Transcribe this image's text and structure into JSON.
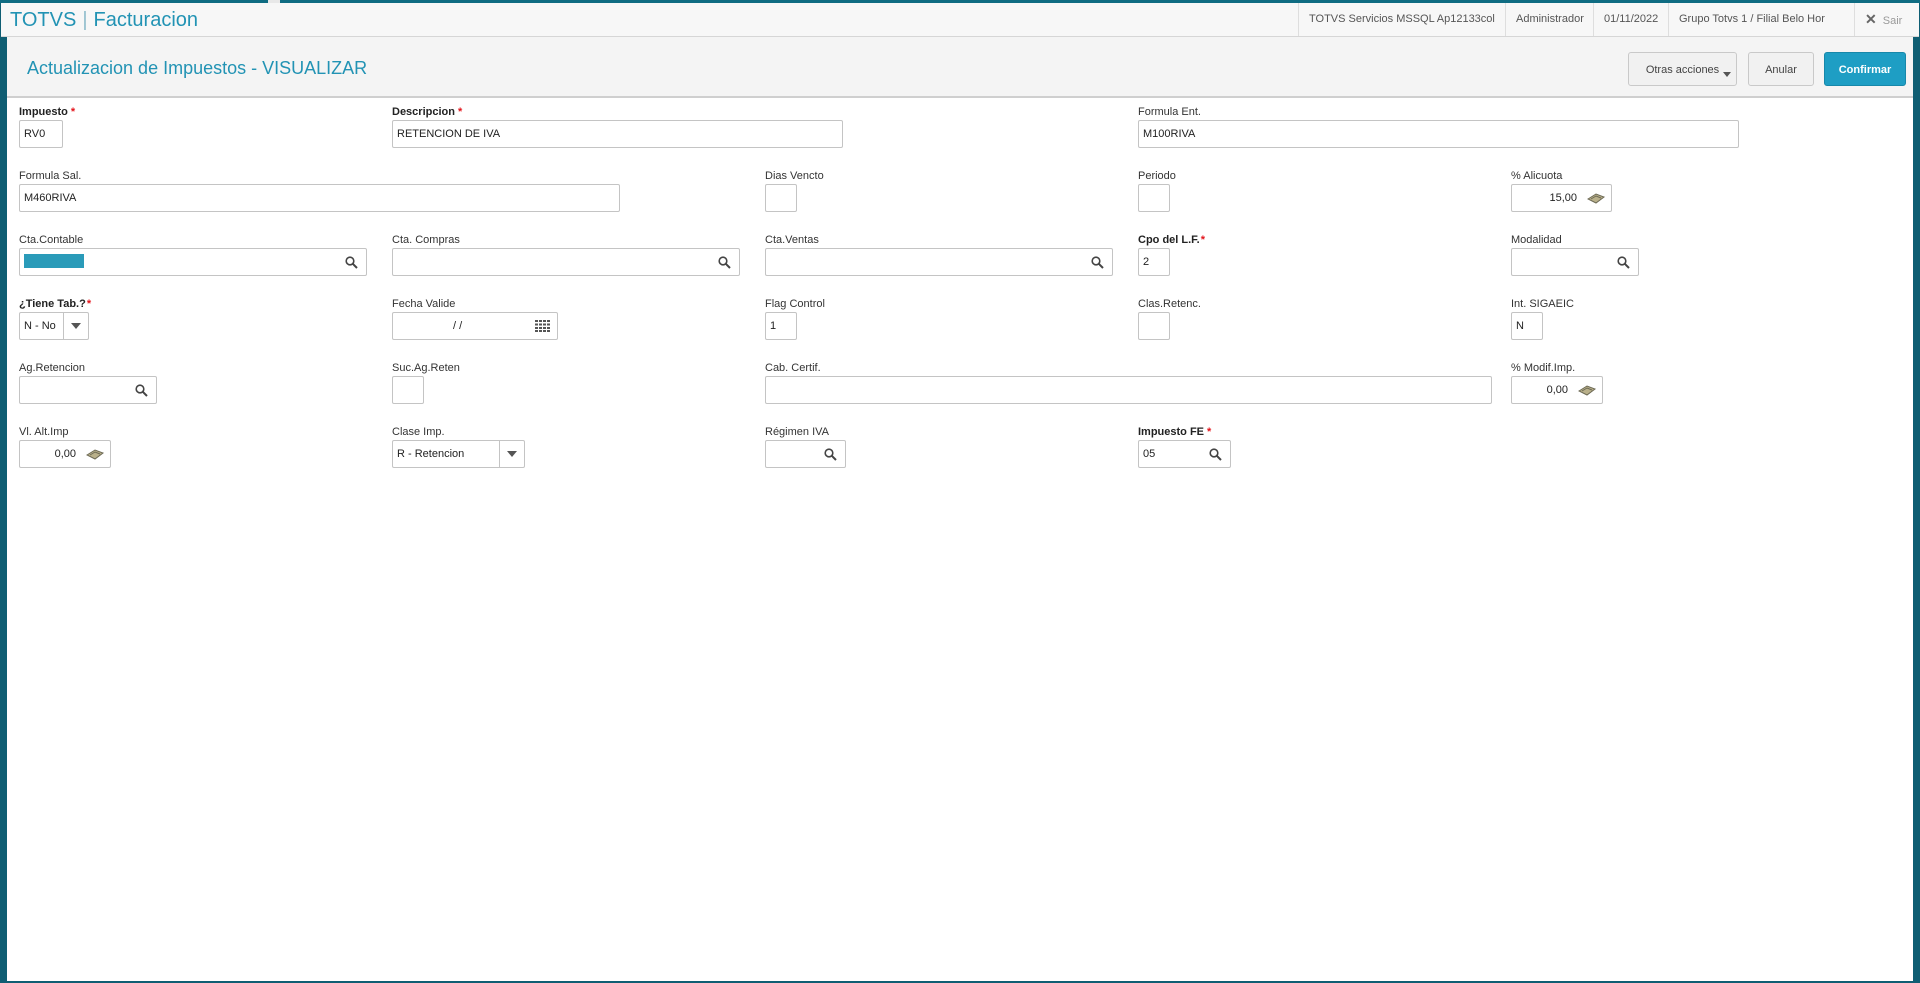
{
  "header": {
    "brand": "TOTVS",
    "module": "Facturacion",
    "server": "TOTVS Servicios MSSQL Ap12133col",
    "user": "Administrador",
    "date": "01/11/2022",
    "branch": "Grupo Totvs 1 / Filial Belo Hor",
    "exit_label": "Sair"
  },
  "page": {
    "title": "Actualizacion de Impuestos - VISUALIZAR",
    "other_actions_label": "Otras acciones",
    "cancel_label": "Anular",
    "confirm_label": "Confirmar"
  },
  "form": {
    "impuesto": {
      "label": "Impuesto",
      "value": "RV0"
    },
    "descripcion": {
      "label": "Descripcion",
      "value": "RETENCION DE IVA"
    },
    "formula_ent": {
      "label": "Formula Ent.",
      "value": "M100RIVA"
    },
    "formula_sal": {
      "label": "Formula Sal.",
      "value": "M460RIVA"
    },
    "dias_vencto": {
      "label": "Dias Vencto",
      "value": ""
    },
    "periodo": {
      "label": "Periodo",
      "value": ""
    },
    "alicuota": {
      "label": "% Alicuota",
      "value": "15,00"
    },
    "cta_contable": {
      "label": "Cta.Contable",
      "value": ""
    },
    "cta_compras": {
      "label": "Cta. Compras",
      "value": ""
    },
    "cta_ventas": {
      "label": "Cta.Ventas",
      "value": ""
    },
    "cpo_lf": {
      "label": "Cpo del L.F.",
      "value": "2"
    },
    "modalidad": {
      "label": "Modalidad",
      "value": ""
    },
    "tiene_tab": {
      "label": "¿Tiene Tab.?",
      "value": "N - No"
    },
    "fecha_valide": {
      "label": "Fecha Valide",
      "value": "/ /"
    },
    "flag_control": {
      "label": "Flag Control",
      "value": "1"
    },
    "clas_retenc": {
      "label": "Clas.Retenc.",
      "value": ""
    },
    "int_sigaeic": {
      "label": "Int. SIGAEIC",
      "value": "N"
    },
    "ag_retencion": {
      "label": "Ag.Retencion",
      "value": ""
    },
    "suc_ag_reten": {
      "label": "Suc.Ag.Reten",
      "value": ""
    },
    "cab_certif": {
      "label": "Cab. Certif.",
      "value": ""
    },
    "modif_imp": {
      "label": "% Modif.Imp.",
      "value": "0,00"
    },
    "vl_alt_imp": {
      "label": "Vl. Alt.Imp",
      "value": "0,00"
    },
    "clase_imp": {
      "label": "Clase Imp.",
      "value": "R - Retencion"
    },
    "regimen_iva": {
      "label": "Régimen IVA",
      "value": ""
    },
    "impuesto_fe": {
      "label": "Impuesto FE",
      "value": "05"
    }
  },
  "colors": {
    "accent": "#2293b4",
    "primary_button": "#1e9ec4",
    "required_star": "#e3141b",
    "frame": "#0f5e73"
  }
}
